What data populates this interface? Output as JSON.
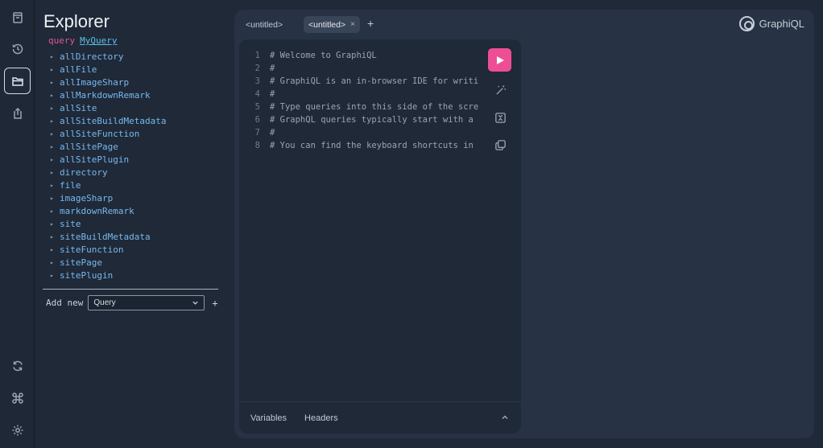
{
  "sidebar": {
    "icons": [
      "docs-icon",
      "history-icon",
      "explorer-icon",
      "export-icon",
      "refetch-icon",
      "shortcuts-icon",
      "settings-icon"
    ],
    "active": "explorer-icon"
  },
  "explorer": {
    "title": "Explorer",
    "operation_keyword": "query",
    "operation_name": "MyQuery",
    "fields": [
      "allDirectory",
      "allFile",
      "allImageSharp",
      "allMarkdownRemark",
      "allSite",
      "allSiteBuildMetadata",
      "allSiteFunction",
      "allSitePage",
      "allSitePlugin",
      "directory",
      "file",
      "imageSharp",
      "markdownRemark",
      "site",
      "siteBuildMetadata",
      "siteFunction",
      "sitePage",
      "sitePlugin"
    ],
    "add_label": "Add new",
    "add_type_value": "Query",
    "add_plus": "+"
  },
  "tabs": [
    {
      "label": "<untitled>",
      "active": false
    },
    {
      "label": "<untitled>",
      "active": true,
      "close": "×"
    }
  ],
  "tab_add": "+",
  "logo_text": "GraphiQL",
  "editor": {
    "lines": [
      {
        "num": "1",
        "text": "# Welcome to GraphiQL"
      },
      {
        "num": "2",
        "text": "#"
      },
      {
        "num": "3",
        "text": "# GraphiQL is an in-browser IDE for writi"
      },
      {
        "num": "4",
        "text": "#"
      },
      {
        "num": "5",
        "text": "# Type queries into this side of the scre"
      },
      {
        "num": "6",
        "text": "# GraphQL queries typically start with a"
      },
      {
        "num": "7",
        "text": "#"
      },
      {
        "num": "8",
        "text": "# You can find the keyboard shortcuts in"
      }
    ]
  },
  "bottom_tabs": {
    "variables": "Variables",
    "headers": "Headers"
  },
  "colors": {
    "accent": "#ee4f94",
    "field": "#79b8ec",
    "keyword": "#e05599",
    "operation_name": "#5fc0ea"
  }
}
